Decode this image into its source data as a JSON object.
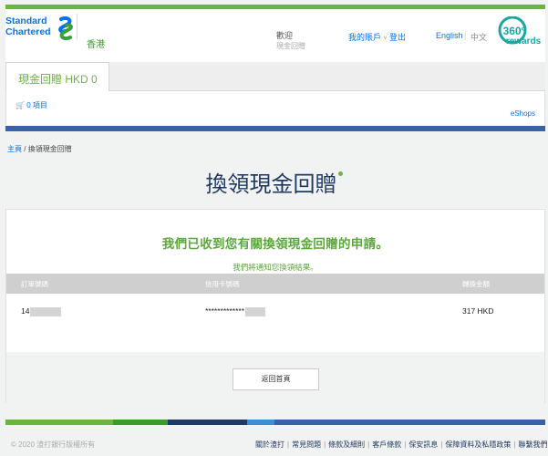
{
  "brand": {
    "logo_line1": "Standard",
    "logo_line2": "Chartered",
    "region": "香港",
    "rewards_number": "360°",
    "rewards_word": "rewards"
  },
  "header": {
    "welcome_label": "歡迎",
    "welcome_sub": "現金回贈",
    "my_account": "我的賬戶",
    "logout": "登出",
    "lang_en": "English",
    "lang_zh": "中文"
  },
  "tab": {
    "label": "現金回贈 HKD 0"
  },
  "cart": {
    "label": "0 項目"
  },
  "eshops": "eShops",
  "breadcrumb": {
    "home": "主頁",
    "separator": "/",
    "current": "換領現金回贈"
  },
  "page_title": "換領現金回贈",
  "confirmation": {
    "message": "我們已收到您有關換領現金回贈的申請。",
    "sub": "我們將通知您換領結果。",
    "columns": [
      "訂單號碼",
      "信用卡號碼",
      "轉換金額"
    ],
    "row": {
      "order_no": "14",
      "card_no": "*************",
      "amount": "317 HKD"
    },
    "back_button": "返回首頁"
  },
  "footer": {
    "copyright": "© 2020 渣打銀行版權所有",
    "links": [
      "關於渣打",
      "常見問題",
      "條款及細則",
      "客戶條款",
      "保安訊息",
      "保障資料及私隱政策",
      "聯繫我們"
    ]
  },
  "colors": {
    "brand_green": "#6cb33f",
    "brand_blue": "#0473ea",
    "navy": "#1f3964",
    "bar_blue": "#3a60a8"
  }
}
